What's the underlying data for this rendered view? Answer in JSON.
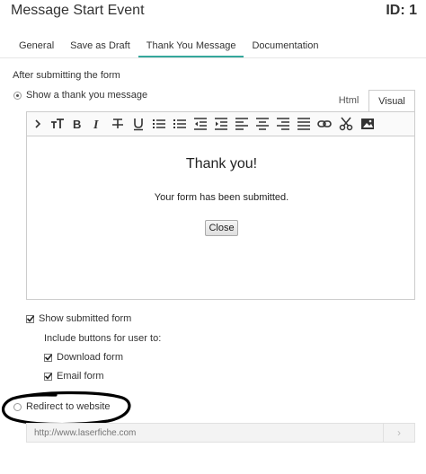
{
  "header": {
    "title": "Message Start Event",
    "id_label": "ID: 1"
  },
  "tabs": [
    {
      "label": "General"
    },
    {
      "label": "Save as Draft"
    },
    {
      "label": "Thank You Message"
    },
    {
      "label": "Documentation"
    }
  ],
  "active_tab": "Thank You Message",
  "section_title": "After submitting the form",
  "options": {
    "show_thank_you_label": "Show a thank you message",
    "show_thank_you_selected": true,
    "redirect_label": "Redirect to website",
    "redirect_selected": false
  },
  "editor_modes": {
    "html_label": "Html",
    "visual_label": "Visual",
    "active": "Visual"
  },
  "toolbar_icons": [
    "expand-icon",
    "font-size-icon",
    "bold-icon",
    "italic-icon",
    "strikethrough-icon",
    "underline-icon",
    "bullet-list-icon",
    "numbered-list-icon",
    "outdent-icon",
    "indent-icon",
    "align-left-icon",
    "align-center-icon",
    "align-right-icon",
    "justify-icon",
    "link-icon",
    "cut-icon",
    "image-icon"
  ],
  "editor": {
    "heading": "Thank you!",
    "body": "Your form has been submitted.",
    "button_label": "Close"
  },
  "submitted_form": {
    "label": "Show submitted form",
    "checked": true,
    "include_label": "Include buttons for user to:",
    "download_label": "Download form",
    "download_checked": true,
    "email_label": "Email form",
    "email_checked": true
  },
  "redirect_url": {
    "placeholder": "http://www.laserfiche.com",
    "go_symbol": "›"
  },
  "colors": {
    "active_tab_underline": "#35a79c",
    "annotation": "#000000"
  }
}
